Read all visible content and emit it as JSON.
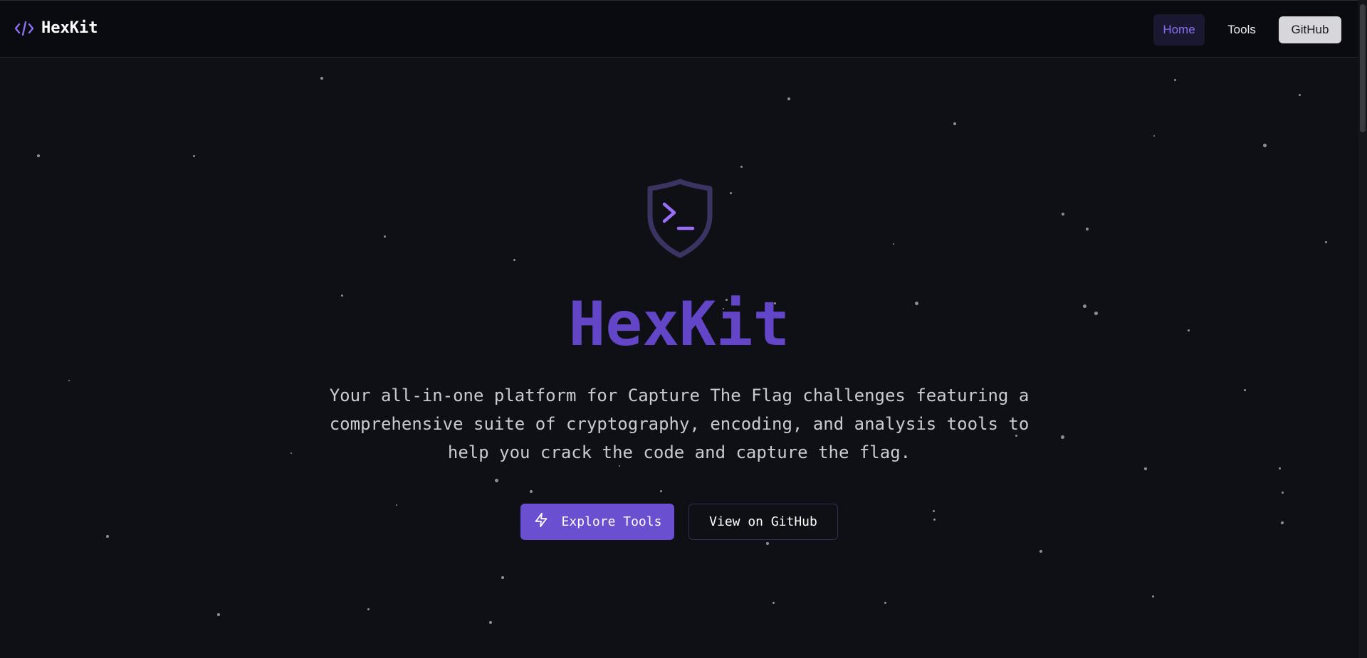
{
  "header": {
    "brand_name": "HexKit",
    "nav": {
      "home": "Home",
      "tools": "Tools",
      "github": "GitHub"
    }
  },
  "hero": {
    "title": "HexKit",
    "description": "Your all-in-one platform for Capture The Flag challenges featuring a comprehensive suite of cryptography, encoding, and analysis tools to help you crack the code and capture the flag.",
    "explore_label": "Explore Tools",
    "github_label": "View on GitHub"
  },
  "colors": {
    "accent": "#6a4fd0",
    "title": "#6346c8",
    "background": "#0f1016"
  },
  "icons": {
    "brand": "code-icon",
    "hero": "shield-terminal-icon",
    "explore": "zap-icon"
  }
}
